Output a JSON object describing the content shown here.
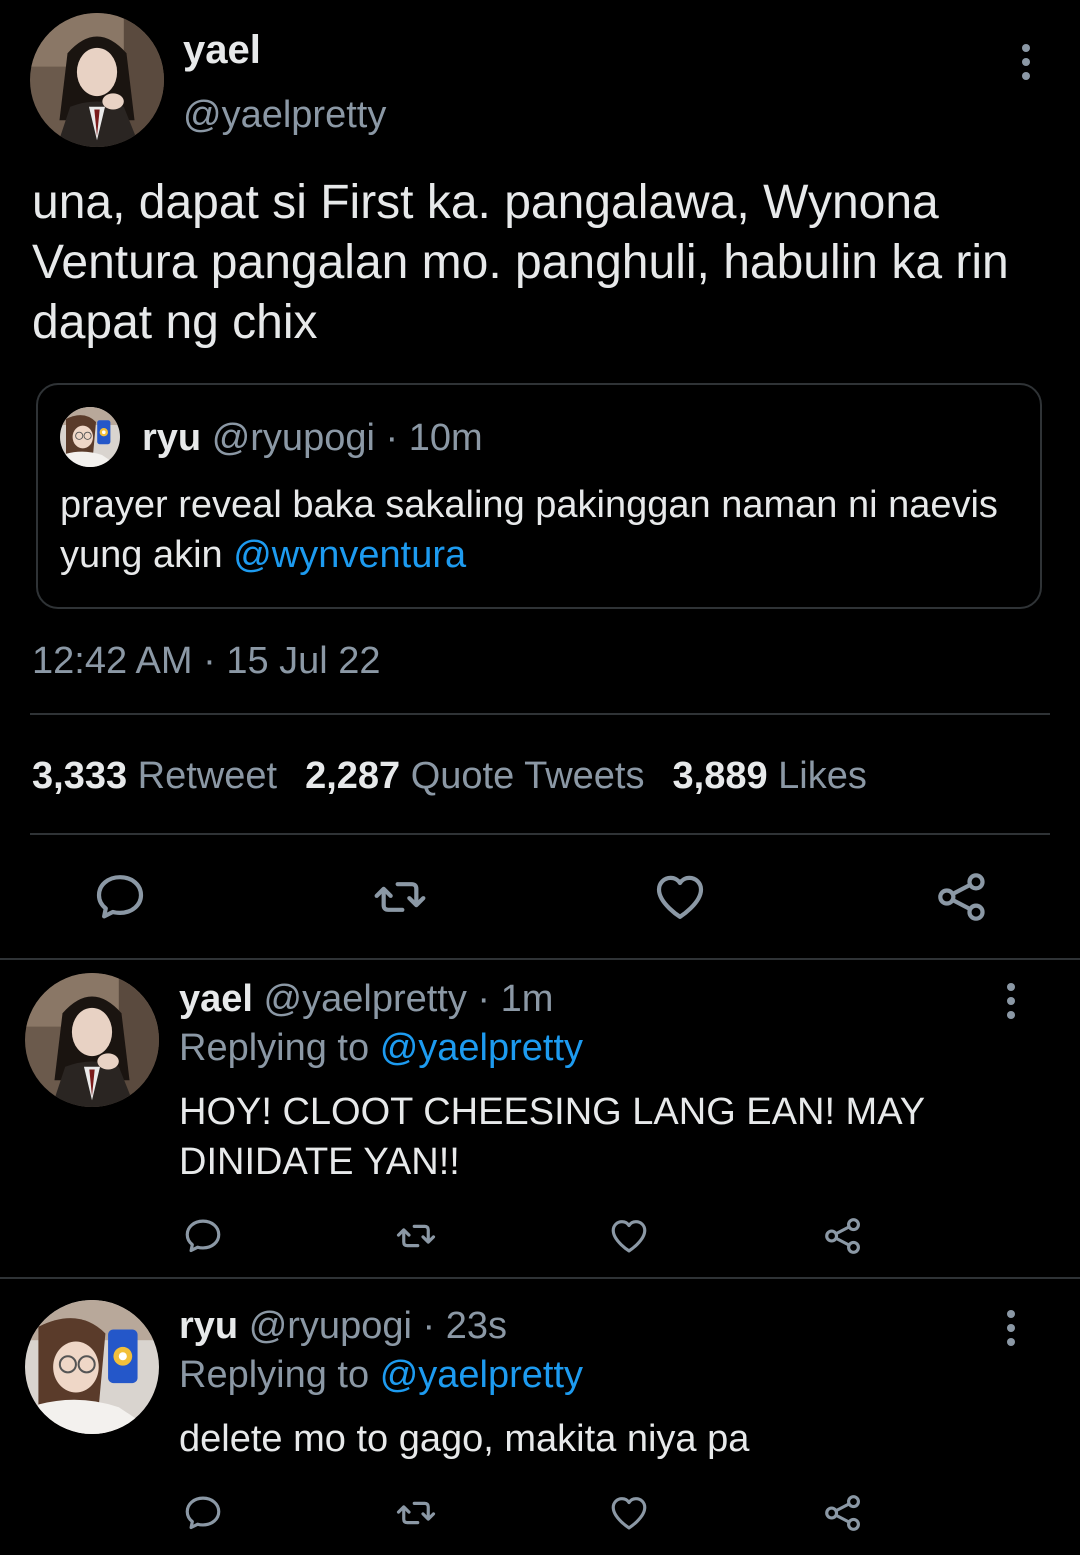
{
  "main_tweet": {
    "author_name": "yael",
    "author_handle": "@yaelpretty",
    "text": "una, dapat si First ka. pangalawa, Wynona Ventura pangalan mo. panghuli, habulin ka rin dapat ng chix",
    "quoted_tweet": {
      "author_name": "ryu",
      "author_handle": "@ryupogi",
      "separator": "·",
      "time": "10m",
      "text": "prayer reveal baka sakaling pakinggan naman ni naevis yung akin",
      "mention": "@wynventura"
    },
    "timestamp": "12:42 AM · 15 Jul 22",
    "stats": {
      "retweets_count": "3,333",
      "retweets_label": "Retweet",
      "quotes_count": "2,287",
      "quotes_label": "Quote Tweets",
      "likes_count": "3,889",
      "likes_label": "Likes"
    },
    "actions": [
      "reply-icon",
      "retweet-icon",
      "like-icon",
      "share-icon"
    ]
  },
  "replies": [
    {
      "author_name": "yael",
      "author_handle": "@yaelpretty",
      "separator": "·",
      "time": "1m",
      "replying_prefix": "Replying to",
      "replying_to": "@yaelpretty",
      "text": "HOY! CLOOT CHEESING LANG EAN! MAY DINIDATE YAN!!"
    },
    {
      "author_name": "ryu",
      "author_handle": "@ryupogi",
      "separator": "·",
      "time": "23s",
      "replying_prefix": "Replying to",
      "replying_to": "@yaelpretty",
      "text": "delete mo to gago, makita niya pa"
    }
  ],
  "colors": {
    "background": "#000000",
    "text": "#e7e9ea",
    "secondary": "#8b98a5",
    "link": "#1d9bf0",
    "divider": "#2f3336"
  }
}
